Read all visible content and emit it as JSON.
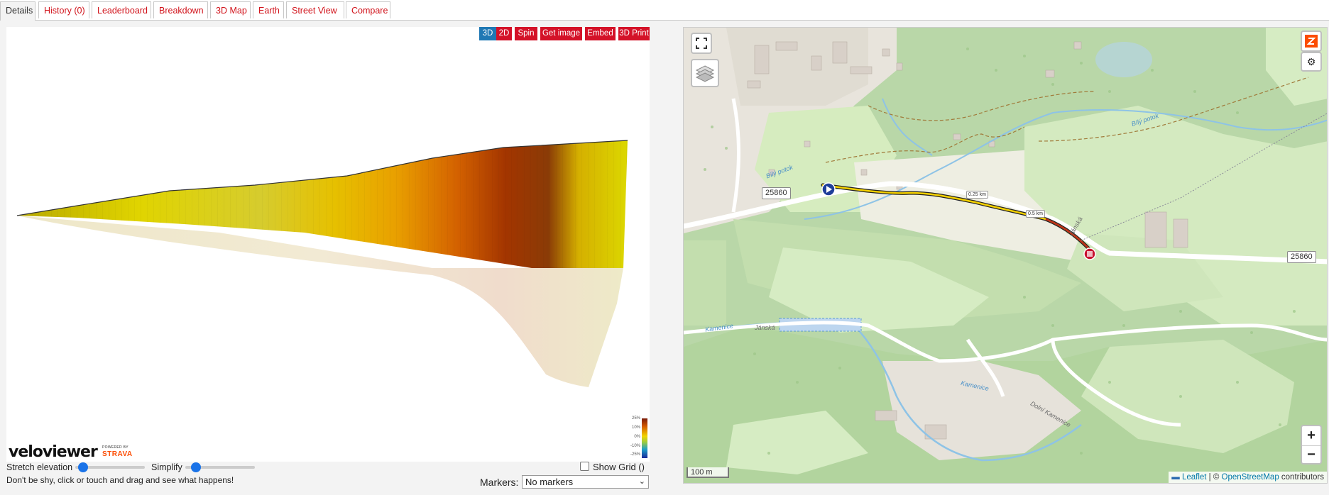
{
  "tabs": [
    {
      "label": "Details",
      "active": true
    },
    {
      "label": "History (0)"
    },
    {
      "label": "Leaderboard"
    },
    {
      "label": "Breakdown"
    },
    {
      "label": "3D Map"
    },
    {
      "label": "Earth"
    },
    {
      "label": "Street View"
    },
    {
      "label": "Compare"
    }
  ],
  "profile_toolbar": {
    "btn_3d": "3D",
    "btn_2d": "2D",
    "spin": "Spin",
    "get_image": "Get image",
    "embed": "Embed",
    "print3d": "3D Print"
  },
  "gradient_legend": {
    "labels": [
      "25%",
      "10%",
      "0%",
      "-10%",
      "-25%"
    ],
    "colors": [
      "#7a1b0a",
      "#d45a00",
      "#f2d500",
      "#9ccc40",
      "#1ea0c8",
      "#1a2a9a"
    ]
  },
  "logo": {
    "brand": "veloviewer",
    "powered_by": "POWERED BY",
    "partner": "STRAVA"
  },
  "controls": {
    "stretch_label": "Stretch elevation",
    "simplify_label": "Simplify",
    "stretch_value": 0.05,
    "simplify_value": 0.1,
    "show_grid": "Show Grid ()",
    "hint": "Don't be shy, click or touch and drag and see what happens!",
    "markers_label": "Markers:",
    "markers_value": "No markers"
  },
  "map": {
    "road_labels": [
      "25860",
      "25860"
    ],
    "km_labels": [
      "0.25 km",
      "0.5 km"
    ],
    "place_labels": [
      "Bílý potok",
      "Bílý potok",
      "Kamenice",
      "Kamenice",
      "Jánská",
      "Jánská",
      "Dolní Kamenice"
    ],
    "scale": "100 m",
    "attribution_leaflet": "Leaflet",
    "attribution_sep": " | © ",
    "attribution_osm": "OpenStreetMap",
    "attribution_tail": " contributors",
    "zoom_in": "+",
    "zoom_out": "−"
  }
}
